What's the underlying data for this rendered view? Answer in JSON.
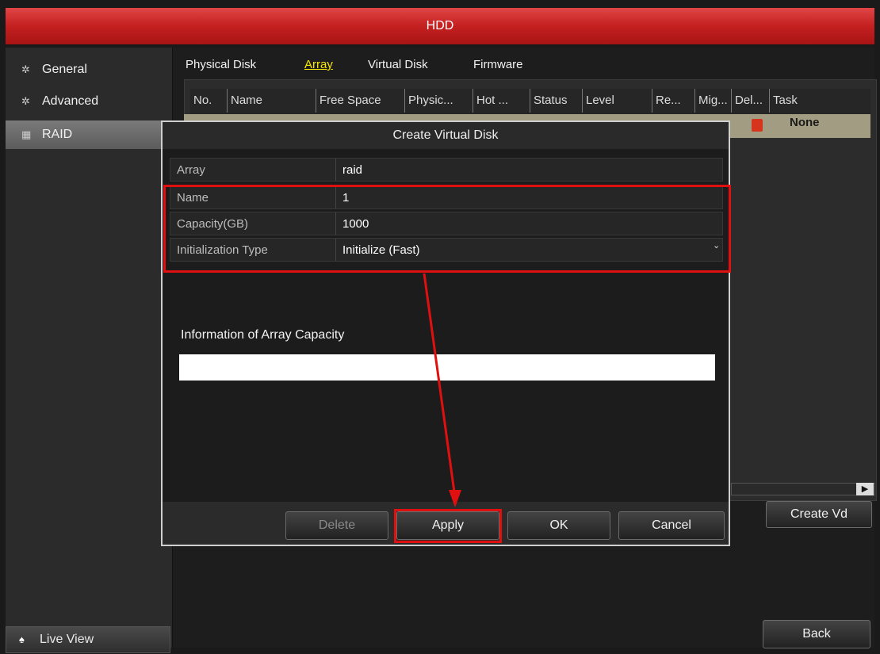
{
  "window": {
    "title": "HDD"
  },
  "sidebar": {
    "items": [
      {
        "label": "General",
        "icon": "gear-icon",
        "glyph": "✲"
      },
      {
        "label": "Advanced",
        "icon": "gear-advanced-icon",
        "glyph": "✲"
      },
      {
        "label": "RAID",
        "icon": "grid-icon",
        "glyph": "▦"
      }
    ],
    "live_view": {
      "label": "Live View",
      "glyph": "♠"
    }
  },
  "tabs": [
    {
      "label": "Physical Disk"
    },
    {
      "label": "Array",
      "active": true
    },
    {
      "label": "Virtual Disk"
    },
    {
      "label": "Firmware"
    }
  ],
  "table": {
    "columns": [
      "No.",
      "Name",
      "Free Space",
      "Physic...",
      "Hot ...",
      "Status",
      "Level",
      "Re...",
      "Mig...",
      "Del...",
      "Task"
    ],
    "rows": [
      {
        "task": "None"
      }
    ]
  },
  "buttons": {
    "create_vd": "Create Vd",
    "back": "Back"
  },
  "dialog": {
    "title": "Create Virtual Disk",
    "fields": [
      {
        "label": "Array",
        "value": "raid"
      },
      {
        "label": "Name",
        "value": "1"
      },
      {
        "label": "Capacity(GB)",
        "value": "1000"
      },
      {
        "label": "Initialization Type",
        "value": "Initialize (Fast)"
      }
    ],
    "info_label": "Information of Array Capacity",
    "buttons": {
      "delete": "Delete",
      "apply": "Apply",
      "ok": "OK",
      "cancel": "Cancel"
    }
  },
  "colors": {
    "title_bar": "#c42020",
    "highlight_box": "#e01010",
    "active_tab": "#f6e600"
  }
}
